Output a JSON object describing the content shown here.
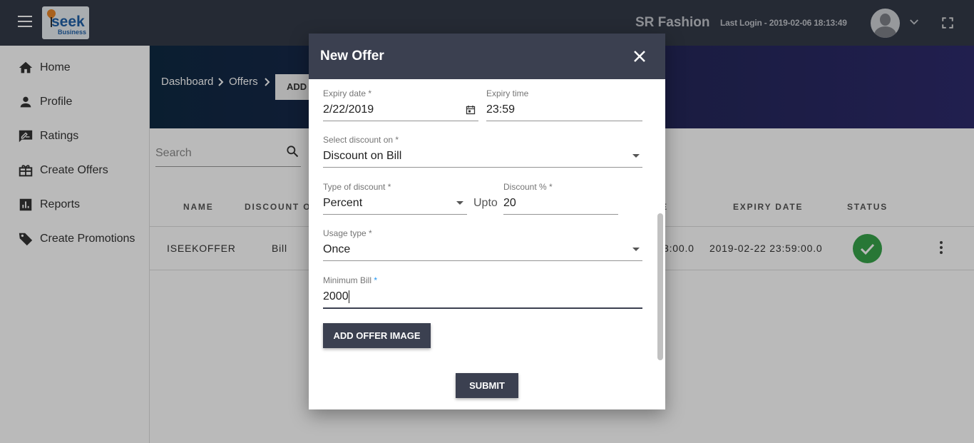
{
  "app": {
    "logo_text": "seek",
    "logo_prefix": "i",
    "logo_sub": "Business",
    "shop_name": "SR Fashion",
    "last_login": "Last Login - 2019-02-06 18:13:49"
  },
  "sidebar": {
    "items": [
      {
        "label": "Home",
        "icon": "home-icon"
      },
      {
        "label": "Profile",
        "icon": "person-icon"
      },
      {
        "label": "Ratings",
        "icon": "rate-review-icon"
      },
      {
        "label": "Create Offers",
        "icon": "gift-icon"
      },
      {
        "label": "Reports",
        "icon": "bar-chart-icon"
      },
      {
        "label": "Create Promotions",
        "icon": "tag-icon"
      }
    ]
  },
  "breadcrumb": {
    "items": [
      "Dashboard",
      "Offers"
    ],
    "add_label": "ADD"
  },
  "search": {
    "placeholder": "Search"
  },
  "table": {
    "headers": [
      "NAME",
      "DISCOUNT O",
      "E",
      "EXPIRY DATE",
      "STATUS"
    ],
    "row": {
      "name": "ISEEKOFFER",
      "discount_on": "Bill",
      "start_partial": "3:00.0",
      "expiry": "2019-02-22 23:59:00.0",
      "status": "active"
    }
  },
  "dialog": {
    "title": "New Offer",
    "expiry_date_label": "Expiry date *",
    "expiry_date": "2/22/2019",
    "expiry_time_label": "Expiry time",
    "expiry_time": "23:59",
    "discount_on_label": "Select discount on *",
    "discount_on": "Discount on Bill",
    "type_label": "Type of discount *",
    "type": "Percent",
    "upto": "Upto",
    "percent_label": "Discount % *",
    "percent": "20",
    "usage_label": "Usage type *",
    "usage": "Once",
    "min_bill_label": "Minimum Bill",
    "min_bill_req": "*",
    "min_bill": "2000",
    "add_image_label": "ADD OFFER IMAGE",
    "submit_label": "SUBMIT"
  },
  "colors": {
    "topbar": "#333a48",
    "dialog_header": "#3b4050",
    "status_ok": "#37a34a"
  }
}
